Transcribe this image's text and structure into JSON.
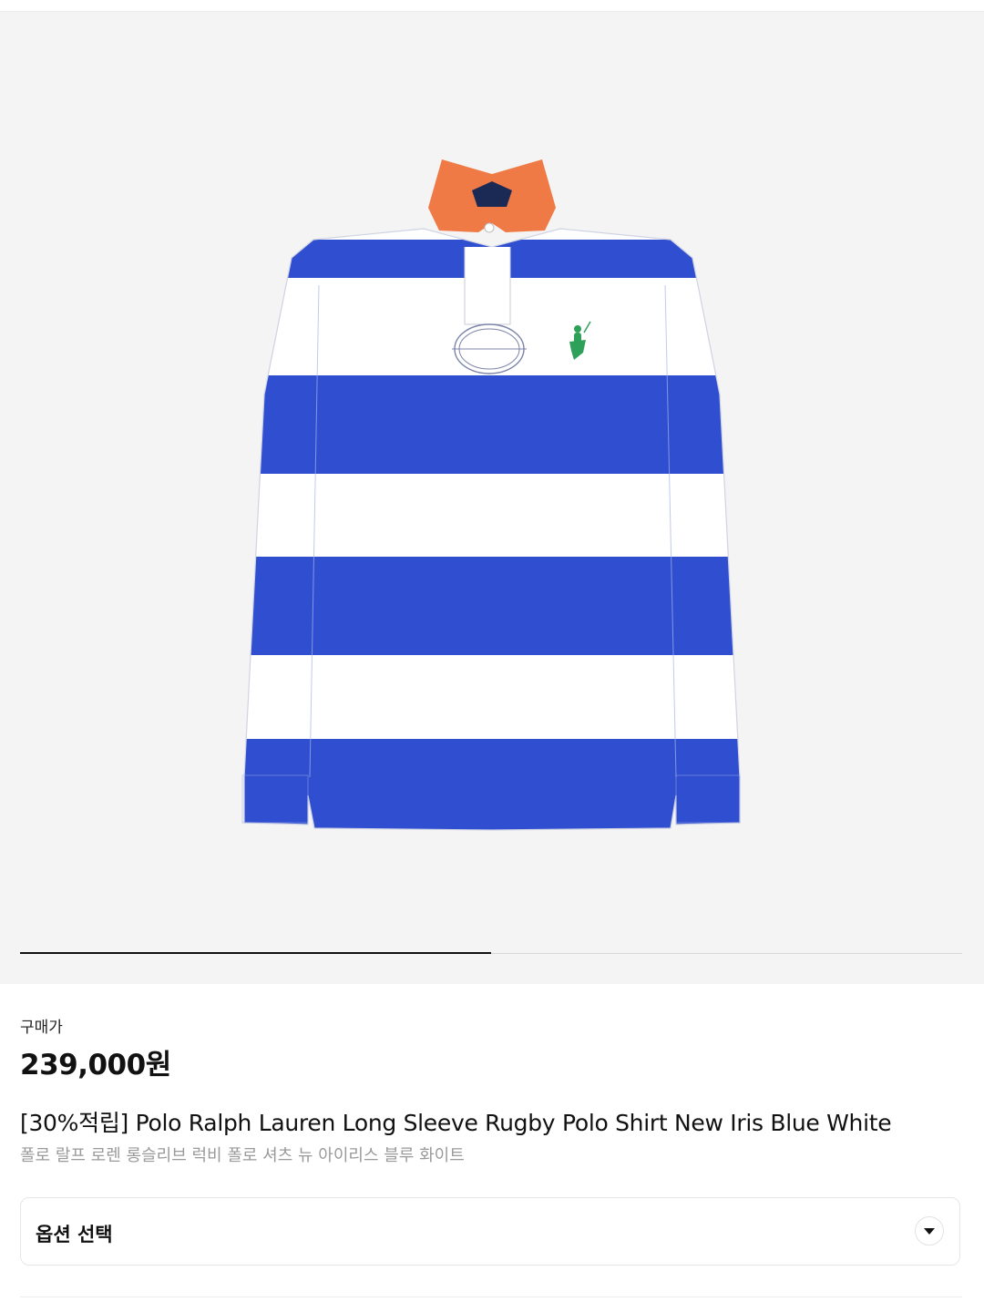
{
  "gallery": {
    "image_alt": "Polo Ralph Lauren long sleeve rugby polo shirt, blue and white stripes with orange collar",
    "progress": 0.5
  },
  "product": {
    "price_label": "구매가",
    "price": "239,000원",
    "title_en": "[30%적립] Polo Ralph Lauren Long Sleeve Rugby Polo Shirt New Iris Blue White",
    "title_ko": "폴로 랄프 로렌 롱슬리브 럭비 폴로 셔츠 뉴 아이리스 블루 화이트"
  },
  "options": {
    "label": "옵션 선택",
    "icon": "chevron-down-icon"
  },
  "colors": {
    "stripe_blue": "#2f4fd0",
    "stripe_white": "#ffffff",
    "collar_orange": "#f07a45",
    "logo_green": "#2fa05a"
  }
}
